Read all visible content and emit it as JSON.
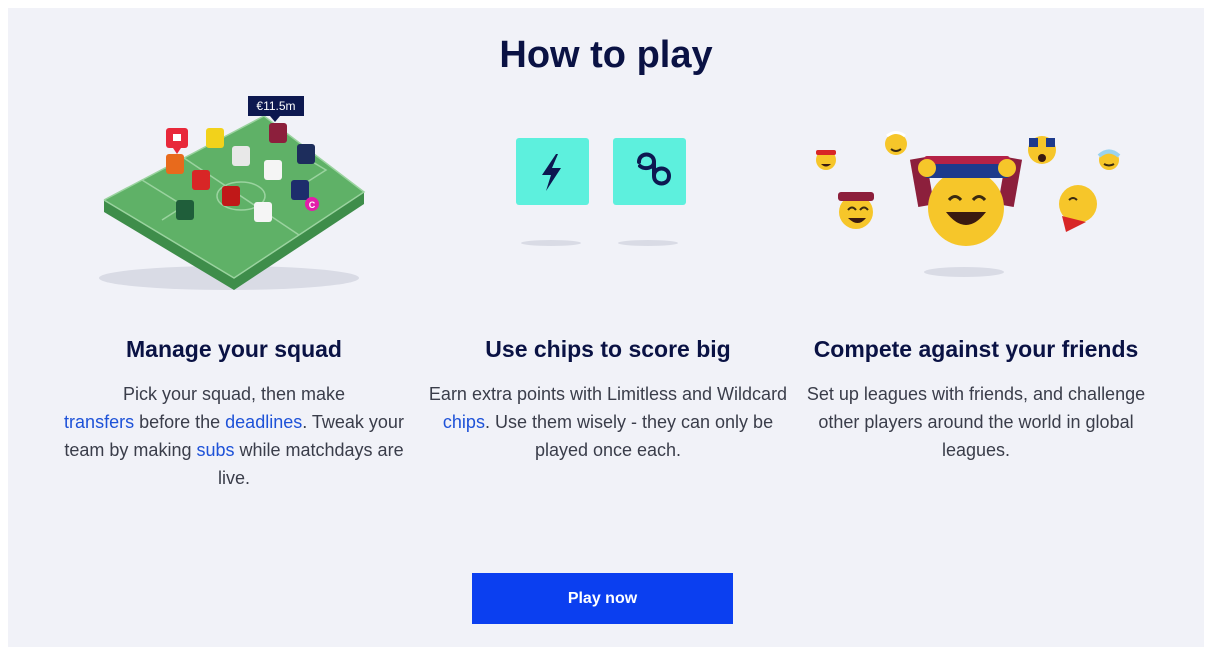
{
  "page_title": "How to play",
  "price_tag": "€11.5m",
  "captain_badge": "C",
  "colors": {
    "heading": "#0a1244",
    "link": "#1e52d8",
    "button": "#0b3ff0",
    "chip_tile": "#5df0dd",
    "pitch": "#5fb167"
  },
  "features": [
    {
      "heading": "Manage your squad",
      "icon": "pitch-illustration",
      "text": {
        "t1": "Pick your squad, then make",
        "link1": "transfers",
        "t2": " before the ",
        "link2": "deadlines",
        "t3": ". Tweak your team by making ",
        "link3": "subs",
        "t4": " while matchdays are live."
      }
    },
    {
      "heading": "Use chips to score big",
      "icons": [
        "lightning-icon",
        "infinity-icon"
      ],
      "text": {
        "t1": "Earn extra points with Limitless and Wildcard ",
        "link1": "chips",
        "t2": ". Use them wisely - they can only be played once each."
      }
    },
    {
      "heading": "Compete against your friends",
      "icon": "fans-emoji-illustration",
      "text": {
        "t1": "Set up leagues with friends, and challenge other players around the world in global leagues."
      }
    }
  ],
  "cta": {
    "label": "Play now"
  }
}
